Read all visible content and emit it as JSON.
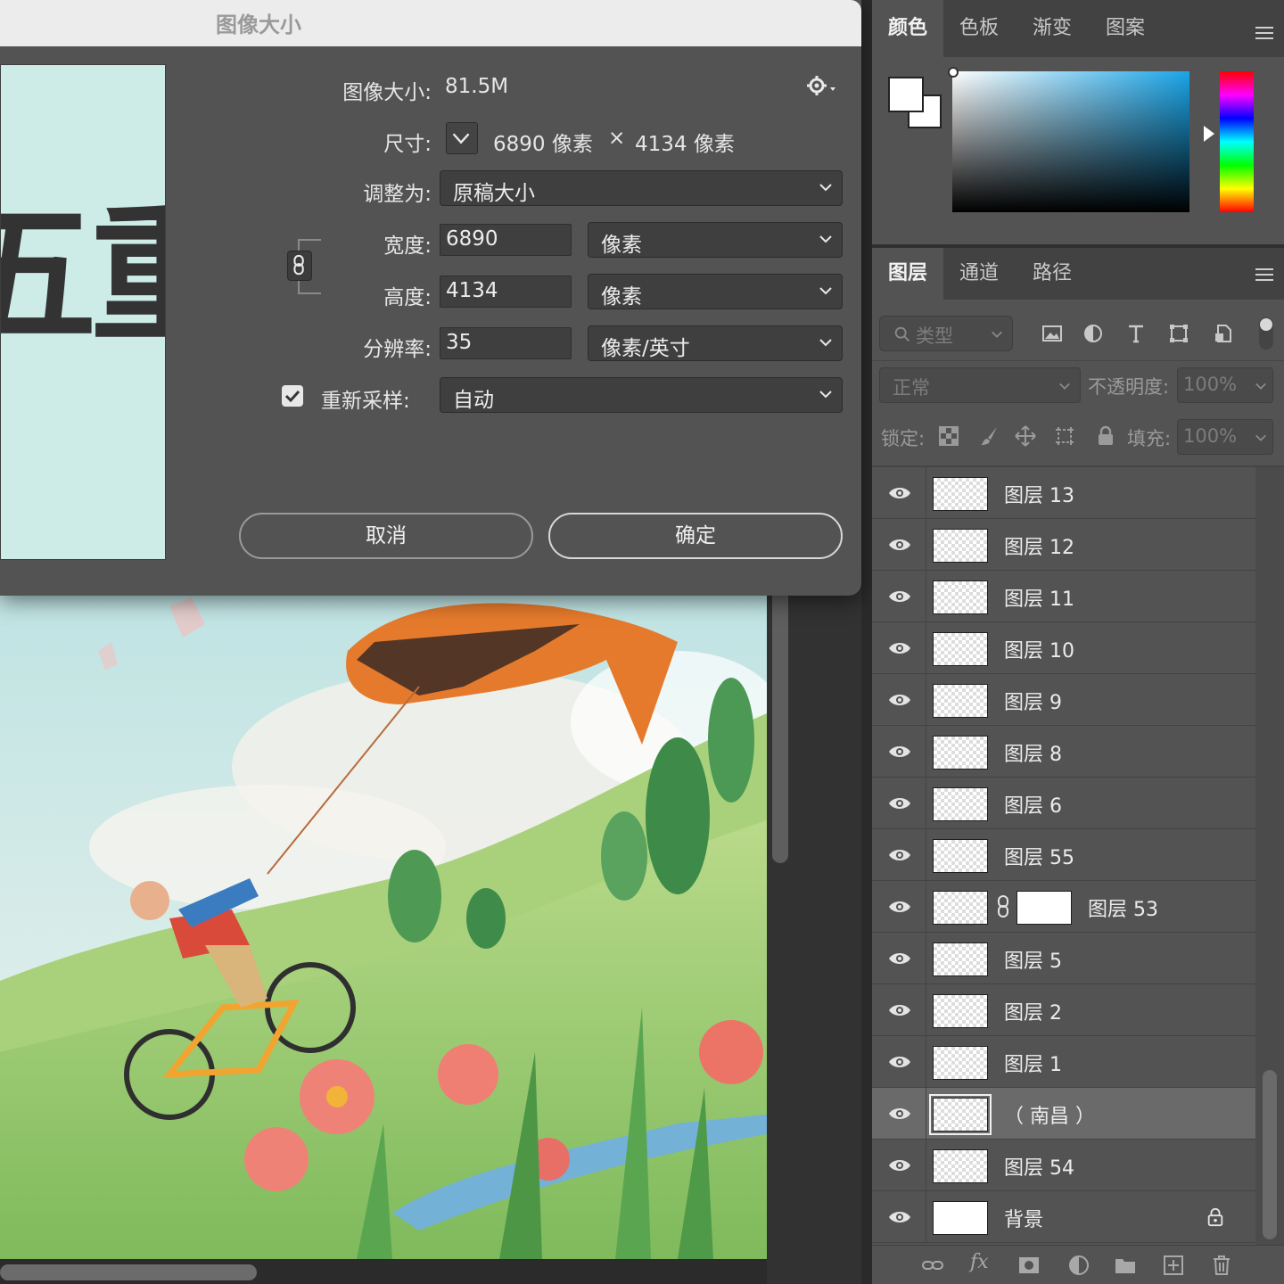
{
  "dialog": {
    "title": "图像大小",
    "image_size_label": "图像大小:",
    "image_size_value": "81.5M",
    "dimensions_label": "尺寸:",
    "dimensions_width": "6890 像素",
    "dimensions_x": "×",
    "dimensions_height": "4134 像素",
    "fit_to_label": "调整为:",
    "fit_to_value": "原稿大小",
    "width_label": "宽度:",
    "width_value": "6890",
    "width_unit": "像素",
    "height_label": "高度:",
    "height_value": "4134",
    "height_unit": "像素",
    "resolution_label": "分辨率:",
    "resolution_value": "35",
    "resolution_unit": "像素/英寸",
    "resample_label": "重新采样:",
    "resample_checked": true,
    "resample_value": "自动",
    "cancel_label": "取消",
    "ok_label": "确定",
    "preview_text": "五重"
  },
  "color_panel": {
    "tabs": [
      "颜色",
      "色板",
      "渐变",
      "图案"
    ],
    "active_tab": 0
  },
  "layers_panel": {
    "tabs": [
      "图层",
      "通道",
      "路径"
    ],
    "active_tab": 0,
    "filter_label": "类型",
    "blend_mode": "正常",
    "opacity_label": "不透明度:",
    "opacity_value": "100%",
    "lock_label": "锁定:",
    "fill_label": "填充:",
    "fill_value": "100%",
    "layers": [
      {
        "name": "图层 13"
      },
      {
        "name": "图层 12"
      },
      {
        "name": "图层 11"
      },
      {
        "name": "图层 10"
      },
      {
        "name": "图层 9"
      },
      {
        "name": "图层 8"
      },
      {
        "name": "图层 6"
      },
      {
        "name": "图层 55"
      },
      {
        "name": "图层 53"
      },
      {
        "name": "图层 5"
      },
      {
        "name": "图层 2"
      },
      {
        "name": "图层 1"
      },
      {
        "name": "（ 南昌 ）"
      },
      {
        "name": "图层 54"
      },
      {
        "name": "背景"
      }
    ],
    "selected_index": 12
  },
  "colors": {
    "accent": "#ffffff",
    "panel_bg": "#535353",
    "selected_row": "#6a6a6a"
  }
}
